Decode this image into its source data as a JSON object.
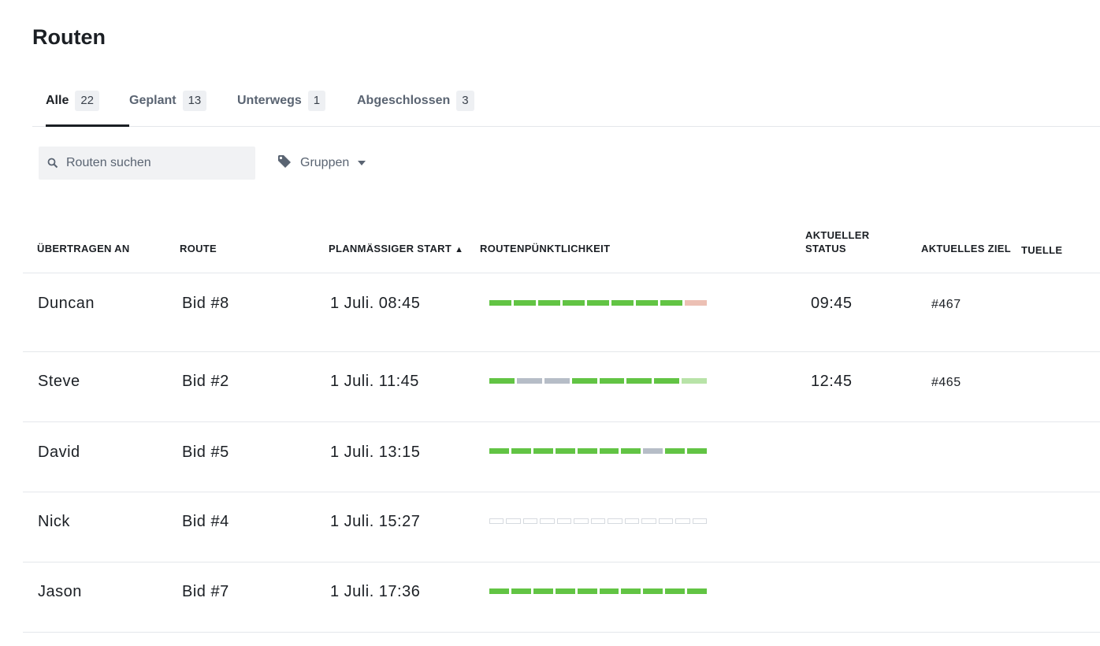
{
  "page": {
    "title": "Routen"
  },
  "tabs": [
    {
      "label": "Alle",
      "count": "22"
    },
    {
      "label": "Geplant",
      "count": "13"
    },
    {
      "label": "Unterwegs",
      "count": "1"
    },
    {
      "label": "Abgeschlossen",
      "count": "3"
    }
  ],
  "search": {
    "placeholder": "Routen suchen",
    "value": ""
  },
  "groups": {
    "label": "Gruppen"
  },
  "columns": {
    "assigned_to": "ÜBERTRAGEN AN",
    "route": "ROUTE",
    "planned_start": "PLANMÄSSIGER START",
    "sort_indicator": "▲",
    "punctuality": "ROUTENPÜNKTLICHKEIT",
    "current_status_1": "AKTUELLER",
    "current_status_2": "STATUS",
    "current_destination": "AKTUELLES ZIEL",
    "truncated": "TUELLE"
  },
  "colors": {
    "green": "#62c444",
    "gray": "#b6bdc7",
    "red": "#ecc0b4",
    "lightgreen": "#b8e3a8",
    "empty_border": "#d6dadf",
    "active_underline": "#1b1f24"
  },
  "rows": [
    {
      "driver": "Duncan",
      "route": "Bid #8",
      "start": "1 Juli. 08:45",
      "status": "09:45",
      "destination": "#467",
      "punctuality": [
        "green",
        "green",
        "green",
        "green",
        "green",
        "green",
        "green",
        "green",
        "red"
      ]
    },
    {
      "driver": "Steve",
      "route": "Bid #2",
      "start": "1 Juli. 11:45",
      "status": "12:45",
      "destination": "#465",
      "punctuality": [
        "green",
        "gray",
        "gray",
        "green",
        "green",
        "green",
        "green",
        "lightgreen"
      ]
    },
    {
      "driver": "David",
      "route": "Bid #5",
      "start": "1 Juli. 13:15",
      "status": "",
      "destination": "",
      "punctuality": [
        "green",
        "green",
        "green",
        "green",
        "green",
        "green",
        "green",
        "gray",
        "green",
        "green"
      ]
    },
    {
      "driver": "Nick",
      "route": "Bid #4",
      "start": "1 Juli. 15:27",
      "status": "",
      "destination": "",
      "punctuality": [
        "empty",
        "empty",
        "empty",
        "empty",
        "empty",
        "empty",
        "empty",
        "empty",
        "empty",
        "empty",
        "empty",
        "empty",
        "empty"
      ]
    },
    {
      "driver": "Jason",
      "route": "Bid #7",
      "start": "1 Juli. 17:36",
      "status": "",
      "destination": "",
      "punctuality": [
        "green",
        "green",
        "green",
        "green",
        "green",
        "green",
        "green",
        "green",
        "green",
        "green"
      ]
    }
  ]
}
